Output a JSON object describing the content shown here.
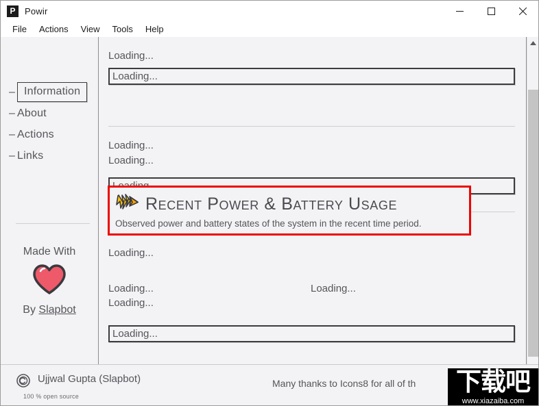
{
  "window": {
    "title": "Powir",
    "icon_letter": "P",
    "controls": [
      {
        "name": "minimize",
        "glyph": "minimize-icon"
      },
      {
        "name": "maximize",
        "glyph": "maximize-icon"
      },
      {
        "name": "close",
        "glyph": "close-icon"
      }
    ]
  },
  "menubar": {
    "items": [
      {
        "label": "File"
      },
      {
        "label": "Actions"
      },
      {
        "label": "View"
      },
      {
        "label": "Tools"
      },
      {
        "label": "Help"
      }
    ]
  },
  "sidebar": {
    "dash": "–",
    "items": [
      {
        "label": "Information",
        "selected": true
      },
      {
        "label": "About",
        "selected": false
      },
      {
        "label": "Actions",
        "selected": false
      },
      {
        "label": "Links",
        "selected": false
      }
    ],
    "made_with_label": "Made With",
    "heart_color": "#ee5a6a",
    "by_prefix": "By ",
    "by_link": "Slapbot"
  },
  "main": {
    "loading_text": "Loading...",
    "section_a": {
      "label": "Loading...",
      "field_value": "Loading..."
    },
    "section_b": {
      "label_1": "Loading...",
      "label_2": "Loading...",
      "field_value": "Loading..."
    },
    "heading_block": {
      "icon": "lightning-bolt-icon",
      "icon_color": "#ffc20e",
      "title": "Recent Power & Battery Usage",
      "subtitle": "Observed power and battery states of the system in the recent time period.",
      "highlight_color": "#ee0000"
    },
    "section_c": {
      "label_1": "Loading...",
      "label_2": "Loading...",
      "label_3": "Loading...",
      "label_right": "Loading...",
      "field_value": "Loading..."
    }
  },
  "scrollbar": {
    "up_arrow": "scroll-up-arrow-icon"
  },
  "footer": {
    "copyright_symbol": "copyright-icon",
    "copyright_text": "Ujjwal Gupta (Slapbot)",
    "open_source_note": "100 % open source",
    "thanks_text": "Many thanks to Icons8 for all of th"
  },
  "watermark": {
    "chinese": "下载吧",
    "url": "www.xiazaiba.com"
  }
}
